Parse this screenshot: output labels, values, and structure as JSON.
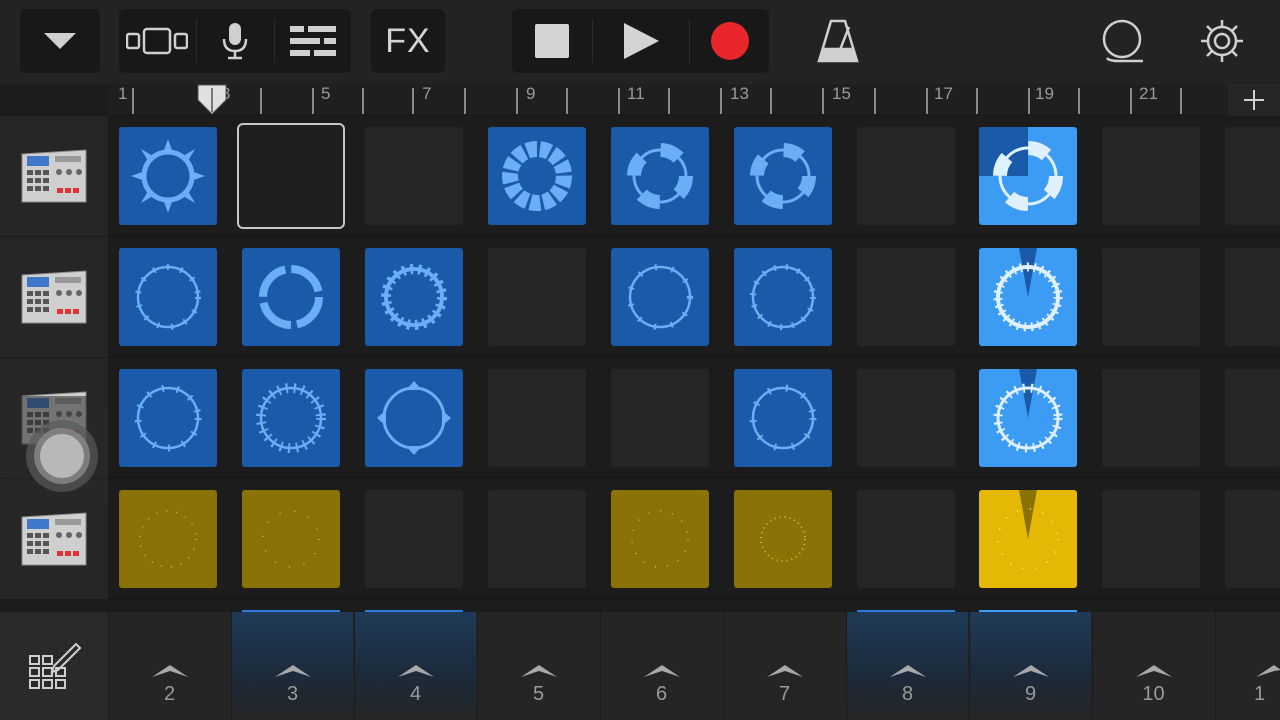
{
  "toolbar": {
    "menu_icon": "triangle-down-icon",
    "view_icon": "tracks-view-icon",
    "mic_icon": "microphone-icon",
    "mixer_icon": "track-controls-icon",
    "fx_label": "FX",
    "stop_icon": "stop-icon",
    "play_icon": "play-icon",
    "record_icon": "record-icon",
    "record_color": "#e8262b",
    "metronome_icon": "metronome-icon",
    "loop_icon": "loop-browser-icon",
    "settings_icon": "gear-icon"
  },
  "ruler": {
    "bars": [
      "1",
      "3",
      "5",
      "7",
      "9",
      "11",
      "13",
      "15",
      "17",
      "19",
      "21"
    ],
    "add_icon": "plus-icon"
  },
  "tracks": [
    {
      "name": "drum-machine-1",
      "icon": "drum-machine-icon"
    },
    {
      "name": "drum-machine-2",
      "icon": "drum-machine-icon"
    },
    {
      "name": "drum-machine-3",
      "icon": "drum-machine-icon"
    },
    {
      "name": "drum-machine-4",
      "icon": "drum-machine-icon"
    }
  ],
  "grid": {
    "rows": [
      [
        "blue-burst",
        "selected-empty",
        "empty",
        "blue-ring-heavy",
        "blue-ring-quad",
        "blue-ring-quad",
        "empty",
        "bright-playing",
        "empty",
        "empty"
      ],
      [
        "blue-ring",
        "blue-ring-thick",
        "blue-ring-wave",
        "empty",
        "blue-ring",
        "blue-ring",
        "empty",
        "bright-playing",
        "empty",
        "empty"
      ],
      [
        "blue-ring",
        "blue-ring-spiky",
        "blue-ring-arrows",
        "empty",
        "empty",
        "blue-ring",
        "empty",
        "bright-playing",
        "empty",
        "empty"
      ],
      [
        "yellow-dots",
        "yellow-dots",
        "empty",
        "empty",
        "yellow-dots",
        "yellow-dots",
        "empty",
        "gold-playing",
        "empty",
        "empty"
      ]
    ],
    "colors": {
      "blue": "#1a5aa8",
      "bright": "#3c9bf3",
      "yellow": "#8a7207",
      "gold": "#e6b806"
    }
  },
  "bottom": {
    "edit_icon": "grid-edit-icon",
    "columns": [
      "2",
      "3",
      "4",
      "5",
      "6",
      "7",
      "8",
      "9",
      "10",
      "1"
    ],
    "trigger_icon": "chevron-up-icon"
  }
}
